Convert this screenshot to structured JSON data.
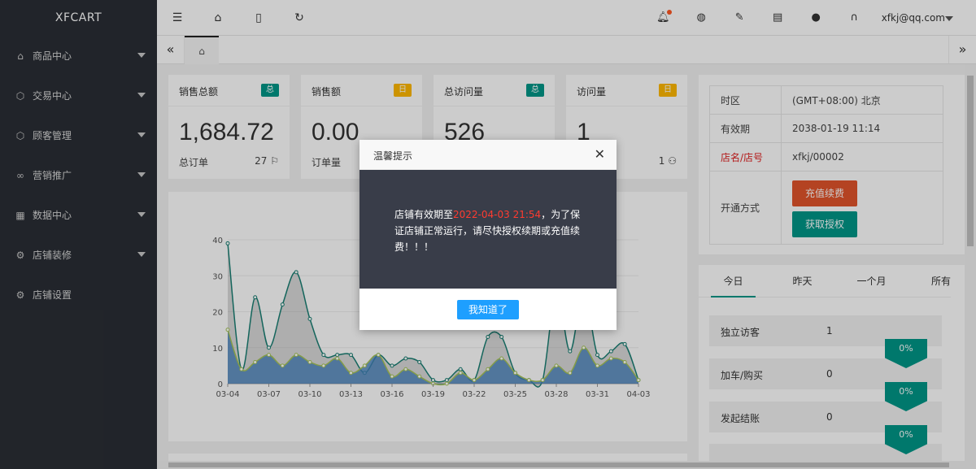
{
  "sidebar": {
    "brand": "XFCART",
    "items": [
      {
        "label": "商品中心",
        "icon": "house-icon",
        "glyph": "⌂"
      },
      {
        "label": "交易中心",
        "icon": "cube-icon",
        "glyph": "⬡"
      },
      {
        "label": "顾客管理",
        "icon": "cube-icon",
        "glyph": "⬡"
      },
      {
        "label": "营销推广",
        "icon": "infinity-icon",
        "glyph": "∞"
      },
      {
        "label": "数据中心",
        "icon": "chart-icon",
        "glyph": "▦"
      },
      {
        "label": "店铺装修",
        "icon": "gear-icon",
        "glyph": "⚙"
      },
      {
        "label": "店铺设置",
        "icon": "gear-icon",
        "glyph": "⚙"
      }
    ]
  },
  "topbar": {
    "user": "xfkj@qq.com"
  },
  "stats": [
    {
      "title": "销售总额",
      "badge": "总",
      "value": "1,684.72",
      "sub": "总订单",
      "sub_value": "27"
    },
    {
      "title": "销售额",
      "badge": "日",
      "value": "0.00",
      "sub": "订单量",
      "sub_value": ""
    },
    {
      "title": "总访问量",
      "badge": "总",
      "value": "526",
      "sub": "",
      "sub_value": ""
    },
    {
      "title": "访问量",
      "badge": "日",
      "value": "1",
      "sub": "",
      "sub_value": "1"
    }
  ],
  "info": {
    "timezone_label": "时区",
    "timezone_value": "(GMT+08:00) 北京",
    "expire_label": "有效期",
    "expire_value": "2038-01-19 11:14",
    "store_label": "店名/店号",
    "store_value": "xfkj/00002",
    "open_label": "开通方式",
    "recharge_btn": "充值续费",
    "auth_btn": "获取授权"
  },
  "traffic": {
    "tabs": [
      "今日",
      "昨天",
      "一个月",
      "所有"
    ],
    "rows": [
      {
        "label": "独立访客",
        "value": "1",
        "pct": "0%"
      },
      {
        "label": "加车/购买",
        "value": "0",
        "pct": "0%"
      },
      {
        "label": "发起结账",
        "value": "0",
        "pct": "0%"
      },
      {
        "label": "",
        "value": "",
        "pct": ""
      }
    ]
  },
  "chart_data": {
    "type": "area",
    "x": [
      "03-04",
      "03-05",
      "03-06",
      "03-07",
      "03-08",
      "03-09",
      "03-10",
      "03-11",
      "03-12",
      "03-13",
      "03-14",
      "03-15",
      "03-16",
      "03-17",
      "03-18",
      "03-19",
      "03-20",
      "03-21",
      "03-22",
      "03-23",
      "03-24",
      "03-25",
      "03-26",
      "03-27",
      "03-28",
      "03-29",
      "03-30",
      "03-31",
      "04-01",
      "04-02",
      "04-03"
    ],
    "x_ticks": [
      "03-04",
      "03-07",
      "03-10",
      "03-13",
      "03-16",
      "03-19",
      "03-22",
      "03-25",
      "03-28",
      "03-31",
      "04-03"
    ],
    "y_ticks": [
      0,
      10,
      20,
      30,
      40
    ],
    "ylim": [
      0,
      40
    ],
    "series": [
      {
        "values": [
          39,
          4,
          24,
          10,
          22,
          31,
          18,
          8,
          8,
          8,
          3,
          8,
          5,
          7,
          6,
          1,
          1,
          4,
          1,
          13,
          13,
          3,
          1,
          1,
          26,
          9,
          26,
          8,
          9,
          11,
          1
        ],
        "color": "#1a7f73",
        "fill": "rgba(150,150,150,0.35)"
      },
      {
        "values": [
          15,
          4,
          6,
          8,
          5,
          8,
          6,
          5,
          7,
          3,
          5,
          8,
          2,
          4,
          2,
          0,
          0,
          3,
          1,
          4,
          7,
          3,
          1,
          1,
          5,
          3,
          10,
          5,
          7,
          6,
          1
        ],
        "color": "#a6c45a",
        "fill": "rgba(70,130,190,0.8)"
      }
    ]
  },
  "modal": {
    "title": "温馨提示",
    "text_before": "店铺有效期至",
    "date": "2022-04-03 21:54",
    "text_after": "，为了保证店铺正常运行，请尽快授权续期或充值续费！！！",
    "button": "我知道了"
  }
}
